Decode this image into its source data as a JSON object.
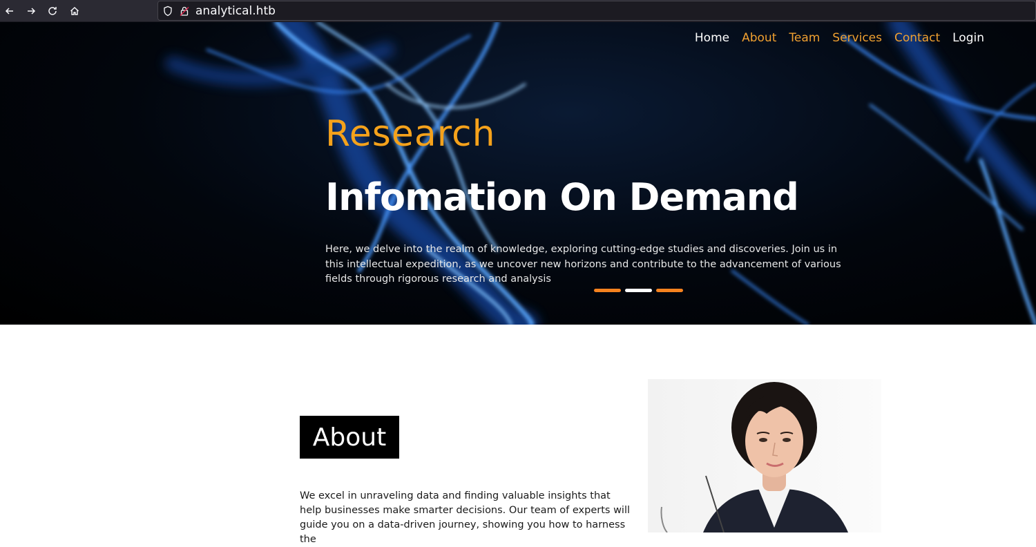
{
  "browser": {
    "url": "analytical.htb",
    "icons": [
      "back-arrow-icon",
      "forward-arrow-icon",
      "reload-icon",
      "home-icon",
      "shield-icon",
      "lock-icon"
    ]
  },
  "nav": {
    "home": "Home",
    "about": "About",
    "team": "Team",
    "services": "Services",
    "contact": "Contact",
    "login": "Login"
  },
  "hero": {
    "subtitle": "Research",
    "title": "Infomation On Demand",
    "text": "Here, we delve into the realm of knowledge, exploring cutting-edge studies and discoveries. Join us in this intellectual expedition, as we uncover new horizons and contribute to the advancement of various fields through rigorous research and analysis"
  },
  "slider": {
    "count": 3,
    "active_index": 1
  },
  "about": {
    "heading": "About",
    "text": "We excel in unraveling data and finding valuable insights that help businesses make smarter decisions. Our team of experts will guide you on a data-driven journey, showing you how to harness the"
  },
  "colors": {
    "accent": "#f5a21b",
    "nav_orange": "#f0a030",
    "hero_bg": "#000000",
    "smoke_blue": "#3a8cff"
  }
}
